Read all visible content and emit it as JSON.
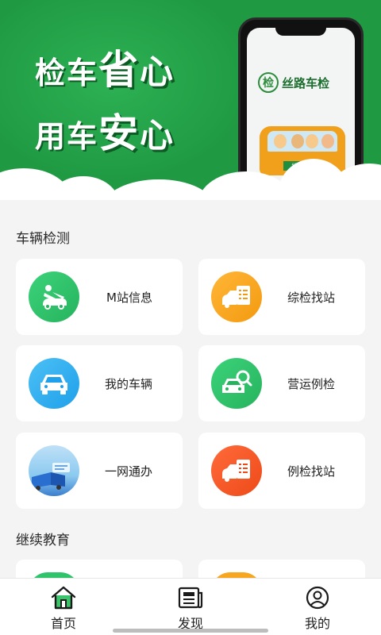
{
  "banner": {
    "line1": {
      "a": "检车",
      "b": "省",
      "c": "心"
    },
    "line2": {
      "a": "用车",
      "b": "安",
      "c": "心"
    },
    "phone": {
      "brand_name": "丝路车检",
      "logo_char": "检",
      "plate_text": "丝路车检"
    }
  },
  "sections": [
    {
      "title": "车辆检测",
      "items": [
        {
          "label": "M站信息",
          "icon": "mechanic-icon",
          "color": "#2fc46b"
        },
        {
          "label": "综检找站",
          "icon": "car-checklist-icon",
          "color": "#f7a620"
        },
        {
          "label": "我的车辆",
          "icon": "car-icon",
          "color": "#27a8ee"
        },
        {
          "label": "营运例检",
          "icon": "car-inspect-icon",
          "color": "#2fc46b"
        },
        {
          "label": "一网通办",
          "icon": "service-photo-icon",
          "color": "#5aa0e6"
        },
        {
          "label": "例检找站",
          "icon": "car-checklist-icon",
          "color": "#f25a25"
        }
      ]
    },
    {
      "title": "继续教育"
    }
  ],
  "tabbar": {
    "tabs": [
      {
        "label": "首页",
        "icon": "home-icon",
        "active": true
      },
      {
        "label": "发现",
        "icon": "newspaper-icon",
        "active": false
      },
      {
        "label": "我的",
        "icon": "profile-icon",
        "active": false
      }
    ]
  },
  "colors": {
    "brand_green": "#1f9a43",
    "active_tab": "#1fa84a"
  }
}
